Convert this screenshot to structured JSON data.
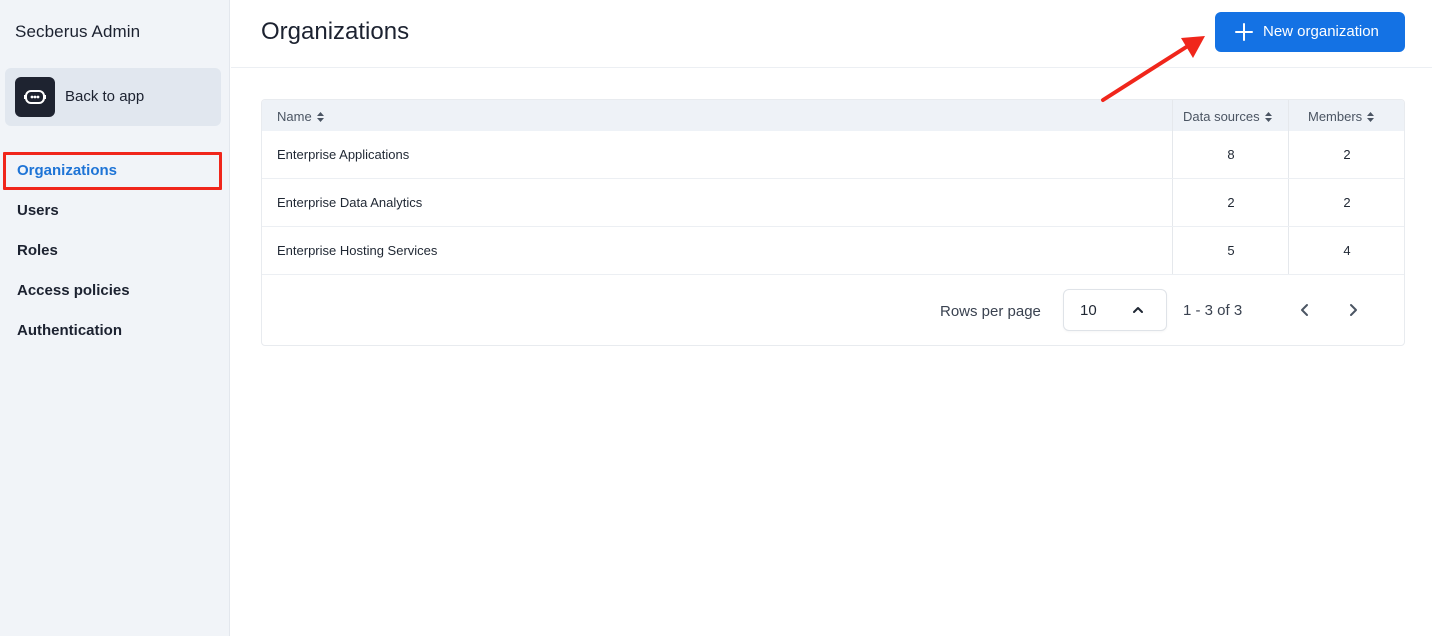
{
  "sidebar": {
    "app_title": "Secberus Admin",
    "back_label": "Back to app",
    "items": [
      {
        "label": "Organizations",
        "active": true
      },
      {
        "label": "Users"
      },
      {
        "label": "Roles"
      },
      {
        "label": "Access policies"
      },
      {
        "label": "Authentication"
      }
    ]
  },
  "header": {
    "title": "Organizations",
    "new_button_label": "New organization"
  },
  "table": {
    "columns": [
      "Name",
      "Data sources",
      "Members"
    ],
    "rows": [
      {
        "name": "Enterprise Applications",
        "data_sources": "8",
        "members": "2"
      },
      {
        "name": "Enterprise Data Analytics",
        "data_sources": "2",
        "members": "2"
      },
      {
        "name": "Enterprise Hosting Services",
        "data_sources": "5",
        "members": "4"
      }
    ]
  },
  "pagination": {
    "rows_per_page_label": "Rows per page",
    "rows_per_page_value": "10",
    "range_text": "1 - 3 of 3"
  },
  "colors": {
    "accent": "#1472e4",
    "annotation": "#f0261b",
    "sidebar_bg": "#f1f4f8"
  }
}
